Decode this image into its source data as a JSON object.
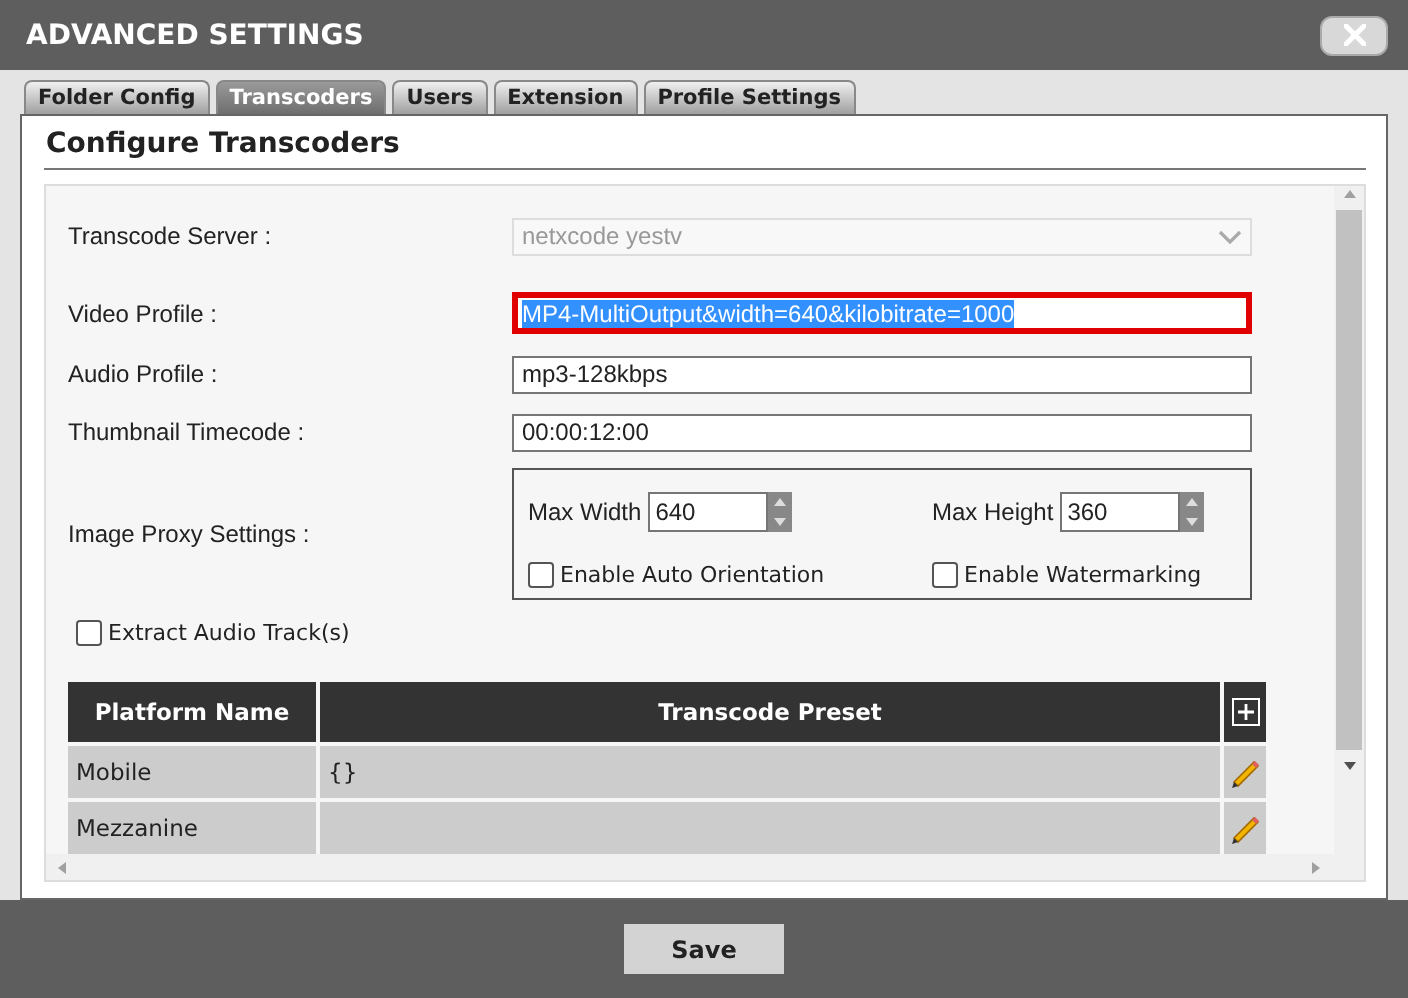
{
  "window": {
    "title": "ADVANCED SETTINGS"
  },
  "tabs": [
    {
      "label": "Folder Config",
      "selected": false
    },
    {
      "label": "Transcoders",
      "selected": true
    },
    {
      "label": "Users",
      "selected": false
    },
    {
      "label": "Extension",
      "selected": false
    },
    {
      "label": "Profile Settings",
      "selected": false
    }
  ],
  "panel": {
    "heading": "Configure Transcoders"
  },
  "fields": [
    {
      "kind": "select",
      "label": "Transcode Server :",
      "value": "netxcode yestv",
      "disabled": true,
      "invalid": false,
      "highlighted": false
    },
    {
      "kind": "text",
      "label": "Video Profile :",
      "value": "MP4-MultiOutput&width=640&kilobitrate=1000",
      "disabled": false,
      "invalid": true,
      "highlighted": true
    },
    {
      "kind": "text",
      "label": "Audio Profile :",
      "value": "mp3-128kbps",
      "disabled": false,
      "invalid": false,
      "highlighted": false
    },
    {
      "kind": "text",
      "label": "Thumbnail Timecode :",
      "value": "00:00:12:00",
      "disabled": false,
      "invalid": false,
      "highlighted": false
    }
  ],
  "image_proxy": {
    "label": "Image Proxy Settings :",
    "spinners": [
      {
        "label": "Max Width",
        "value": "640"
      },
      {
        "label": "Max Height",
        "value": "360"
      }
    ],
    "checkboxes": [
      {
        "label": "Enable Auto Orientation",
        "checked": false
      },
      {
        "label": "Enable Watermarking",
        "checked": false
      }
    ]
  },
  "extract_audio": {
    "label": "Extract Audio Track(s)",
    "checked": false
  },
  "table": {
    "columns": [
      "Platform Name",
      "Transcode Preset"
    ],
    "rows": [
      {
        "platform": "Mobile",
        "preset": "{}"
      },
      {
        "platform": "Mezzanine"
      }
    ]
  },
  "buttons": [
    {
      "label": "Save"
    }
  ]
}
